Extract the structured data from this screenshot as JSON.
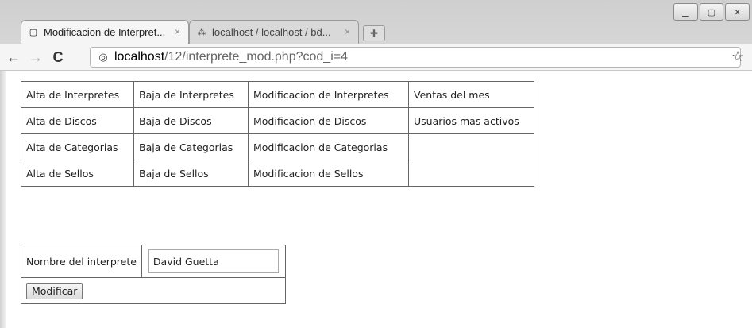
{
  "browser": {
    "tabs": [
      {
        "title": "Modificacion de Interpret...",
        "active": true
      },
      {
        "title": "localhost / localhost / bd...",
        "active": false
      }
    ],
    "url_host": "localhost",
    "url_path": "/12/interprete_mod.php?cod_i=4"
  },
  "menu": {
    "rows": [
      [
        "Alta de Interpretes",
        "Baja de Interpretes",
        "Modificacion de Interpretes",
        "Ventas del mes"
      ],
      [
        "Alta de Discos",
        "Baja de Discos",
        "Modificacion de Discos",
        "Usuarios mas activos"
      ],
      [
        "Alta de Categorias",
        "Baja de Categorias",
        "Modificacion de Categorias",
        ""
      ],
      [
        "Alta de Sellos",
        "Baja de Sellos",
        "Modificacion de Sellos",
        ""
      ]
    ]
  },
  "form": {
    "label": "Nombre del interprete",
    "value": "David Guetta",
    "submit_label": "Modificar"
  }
}
